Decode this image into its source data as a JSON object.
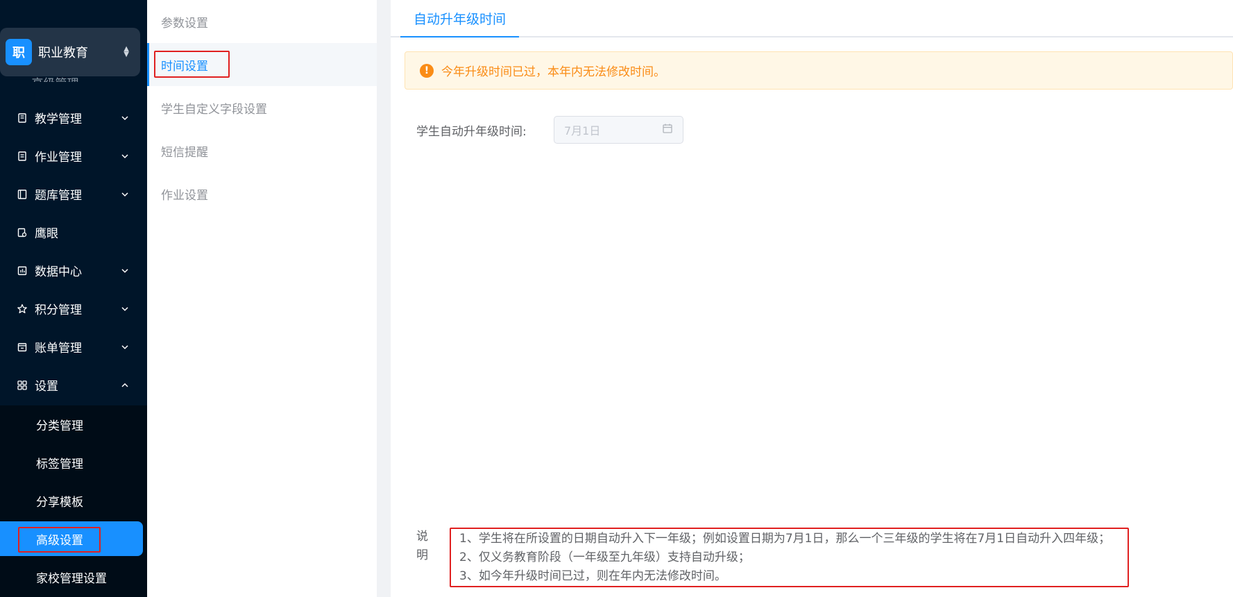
{
  "org": {
    "logo_char": "职",
    "name": "职业教育"
  },
  "sidebar": {
    "items": [
      {
        "label": "教学管理",
        "icon": "book-icon",
        "expand": "down"
      },
      {
        "label": "作业管理",
        "icon": "file-text-icon",
        "expand": "down"
      },
      {
        "label": "题库管理",
        "icon": "question-bank-icon",
        "expand": "down"
      },
      {
        "label": "鹰眼",
        "icon": "monitor-eye-icon",
        "expand": ""
      },
      {
        "label": "数据中心",
        "icon": "bar-chart-icon",
        "expand": "down"
      },
      {
        "label": "积分管理",
        "icon": "star-icon",
        "expand": "down"
      },
      {
        "label": "账单管理",
        "icon": "bill-icon",
        "expand": "down"
      },
      {
        "label": "设置",
        "icon": "apps-grid-icon",
        "expand": "up"
      }
    ],
    "submenu": [
      {
        "label": "分类管理"
      },
      {
        "label": "标签管理"
      },
      {
        "label": "分享模板"
      },
      {
        "label": "高级设置",
        "active": true
      },
      {
        "label": "家校管理设置"
      }
    ]
  },
  "subnav": {
    "items": [
      {
        "label": "参数设置"
      },
      {
        "label": "时间设置",
        "active": true
      },
      {
        "label": "学生自定义字段设置"
      },
      {
        "label": "短信提醒"
      },
      {
        "label": "作业设置"
      }
    ]
  },
  "main": {
    "tab": "自动升年级时间",
    "alert": "今年升级时间已过，本年内无法修改时间。",
    "field_label": "学生自动升年级时间:",
    "date_value": "7月1日",
    "notes_label": "说明",
    "notes": [
      "1、学生将在所设置的日期自动升入下一年级；例如设置日期为7月1日，那么一个三年级的学生将在7月1日自动升入四年级；",
      "2、仅义务教育阶段（一年级至九年级）支持自动升级；",
      "3、如今年升级时间已过，则在年内无法修改时间。"
    ]
  },
  "colors": {
    "primary": "#1890ff",
    "sidebar_bg": "#001529",
    "warning": "#fa8c16",
    "highlight": "#e02020"
  }
}
